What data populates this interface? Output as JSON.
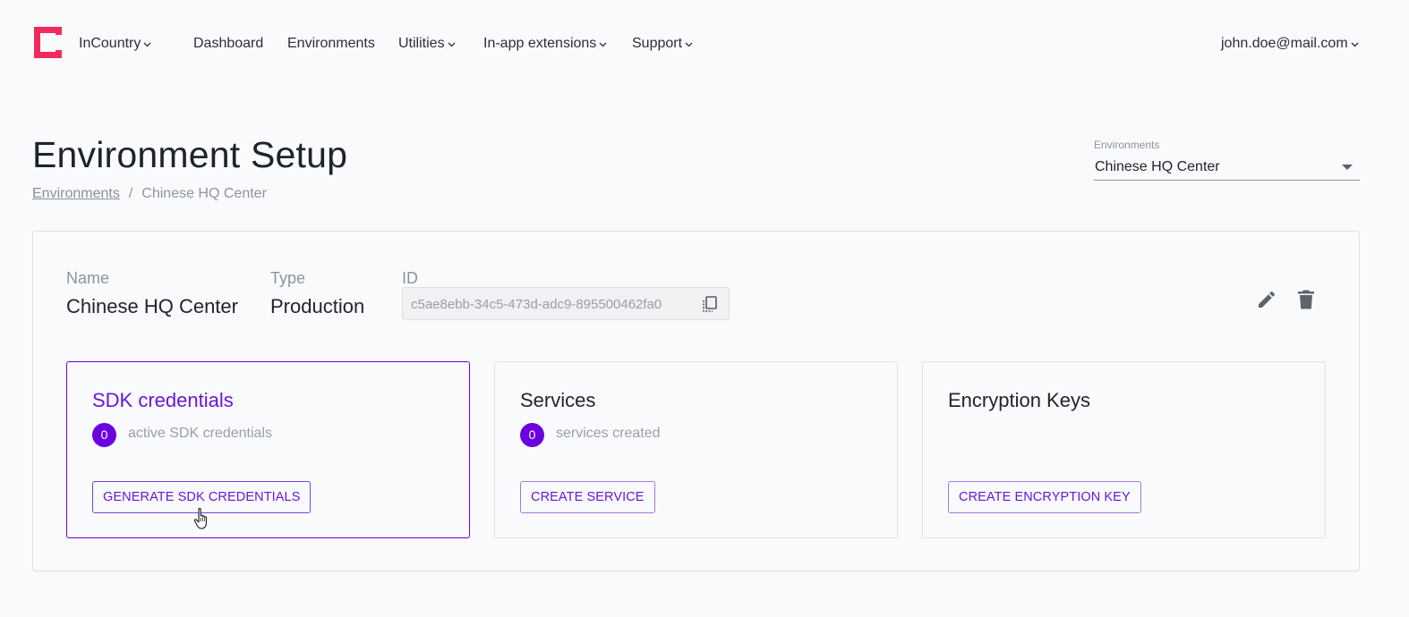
{
  "nav": {
    "brand": "InCountry",
    "items": [
      "Dashboard",
      "Environments",
      "Utilities",
      "In-app extensions",
      "Support"
    ],
    "user": "john.doe@mail.com",
    "brand_color": "#f2295b"
  },
  "header": {
    "title": "Environment Setup",
    "breadcrumb": {
      "link": "Environments",
      "separator": "/",
      "current": "Chinese HQ Center"
    },
    "env_select": {
      "label": "Environments",
      "value": "Chinese HQ Center"
    }
  },
  "details": {
    "name_label": "Name",
    "name_value": "Chinese HQ Center",
    "type_label": "Type",
    "type_value": "Production",
    "id_label": "ID",
    "id_value": "c5ae8ebb-34c5-473d-adc9-895500462fa0"
  },
  "cards": [
    {
      "title": "SDK credentials",
      "count": "0",
      "desc": "active SDK credentials",
      "button": "GENERATE SDK CREDENTIALS"
    },
    {
      "title": "Services",
      "count": "0",
      "desc": "services created",
      "button": "CREATE SERVICE"
    },
    {
      "title": "Encryption Keys",
      "button": "CREATE ENCRYPTION KEY"
    }
  ],
  "accent_color": "#6a00e0"
}
